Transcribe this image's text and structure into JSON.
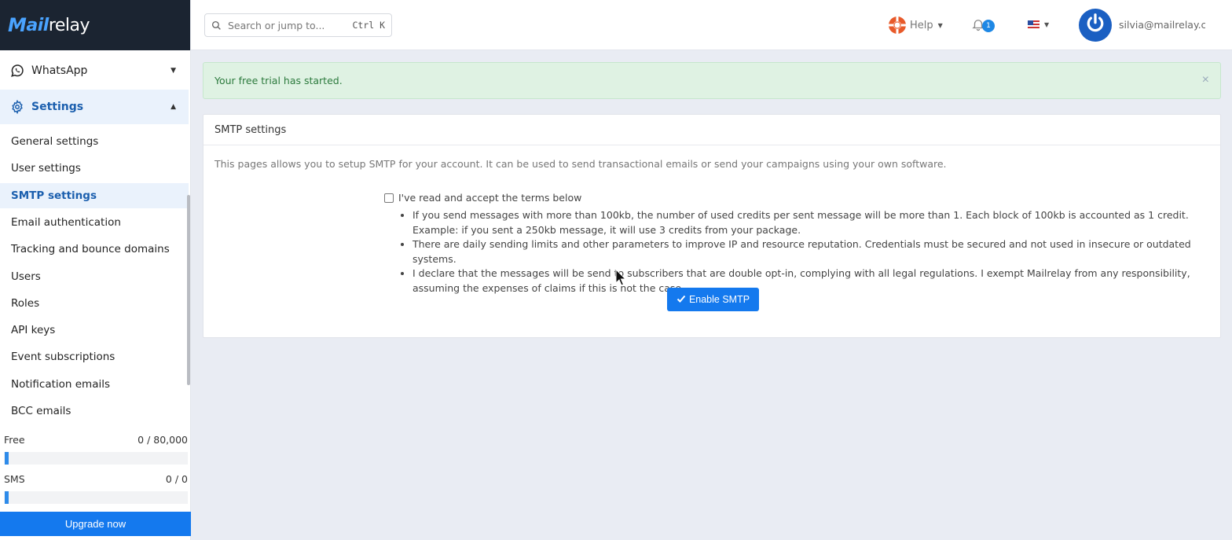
{
  "brand": {
    "logo_m": "M",
    "logo_ail": "ail",
    "logo_relay": "relay"
  },
  "sidebar": {
    "whatsapp_label": "WhatsApp",
    "settings_label": "Settings",
    "items": [
      {
        "label": "General settings"
      },
      {
        "label": "User settings"
      },
      {
        "label": "SMTP settings",
        "active": true
      },
      {
        "label": "Email authentication"
      },
      {
        "label": "Tracking and bounce domains"
      },
      {
        "label": "Users"
      },
      {
        "label": "Roles"
      },
      {
        "label": "API keys"
      },
      {
        "label": "Event subscriptions"
      },
      {
        "label": "Notification emails"
      },
      {
        "label": "BCC emails"
      }
    ],
    "usage": [
      {
        "label": "Free",
        "value": "0 / 80,000",
        "progress": 0.0
      },
      {
        "label": "SMS",
        "value": "0 / 0",
        "progress": 0.0
      }
    ],
    "upgrade_label": "Upgrade now"
  },
  "topbar": {
    "search_placeholder": "Search or jump to...",
    "search_shortcut": "Ctrl K",
    "help_label": "Help",
    "notification_count": "1",
    "user_email": "silvia@mailrelay.com"
  },
  "alert": {
    "message": "Your free trial has started.",
    "close": "×"
  },
  "smtp": {
    "header": "SMTP settings",
    "description": "This pages allows you to setup SMTP for your account. It can be used to send transactional emails or send your campaigns using your own software.",
    "accept_label": "I've read and accept the terms below",
    "terms": [
      "If you send messages with more than 100kb, the number of used credits per sent message will be more than 1. Each block of 100kb is accounted as 1 credit. Example: if you sent a 250kb message, it will use 3 credits from your package.",
      "There are daily sending limits and other parameters to improve IP and resource reputation. Credentials must be secured and not used in insecure or outdated systems.",
      "I declare that the messages will be send to subscribers that are double opt-in, complying with all legal regulations. I exempt Mailrelay from any responsibility, assuming the expenses of claims if this is not the case."
    ],
    "enable_label": "Enable SMTP"
  },
  "colors": {
    "primary": "#1479ee",
    "sidebar_dark": "#1b2431",
    "alert_bg": "#dff2e3",
    "active_bg": "#eaf2fc"
  }
}
